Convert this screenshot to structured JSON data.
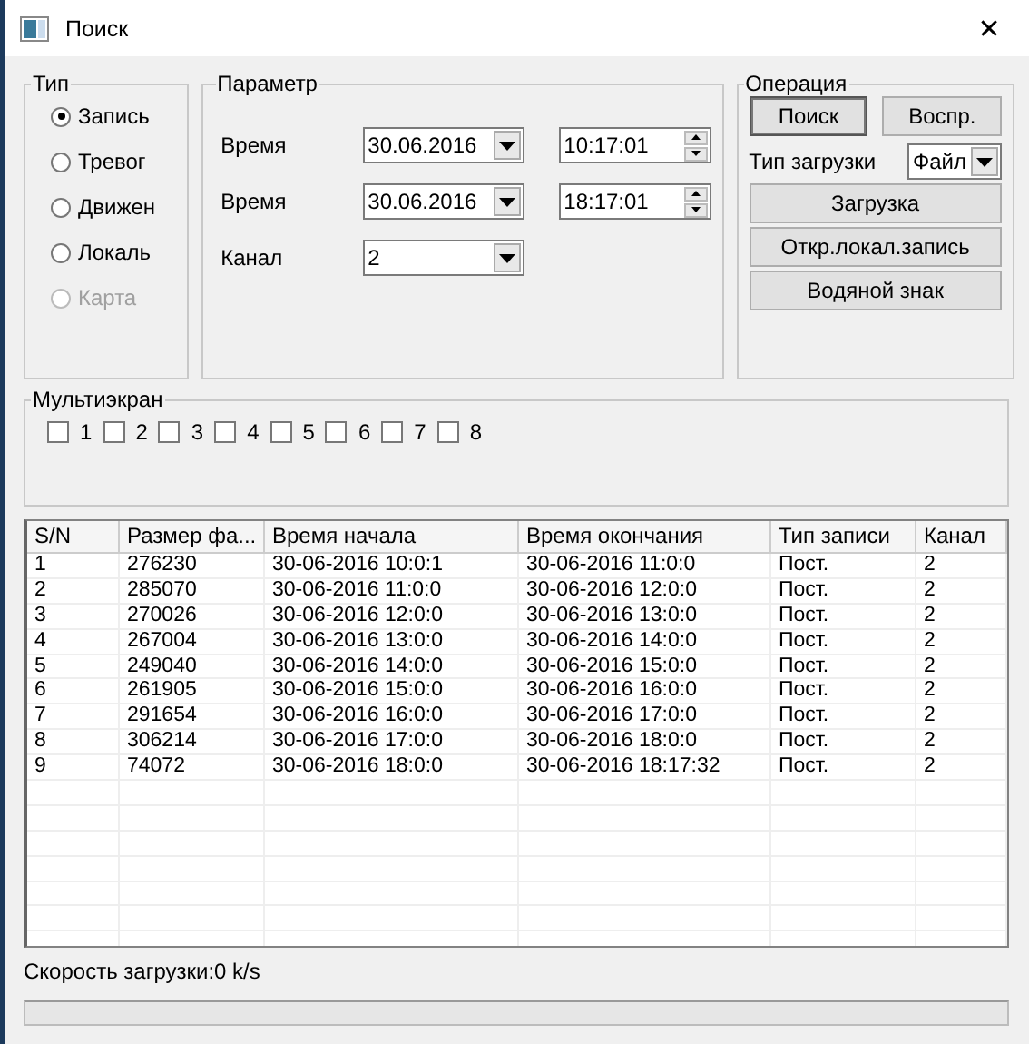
{
  "window": {
    "title": "Поиск",
    "close": "✕"
  },
  "type_group": {
    "title": "Тип",
    "options": [
      {
        "label": "Запись",
        "selected": true,
        "disabled": false
      },
      {
        "label": "Тревог",
        "selected": false,
        "disabled": false
      },
      {
        "label": "Движен",
        "selected": false,
        "disabled": false
      },
      {
        "label": "Локаль",
        "selected": false,
        "disabled": false
      },
      {
        "label": "Карта",
        "selected": false,
        "disabled": true
      }
    ]
  },
  "param_group": {
    "title": "Параметр",
    "rows": [
      {
        "kind": "datetime",
        "label": "Время",
        "date": "30.06.2016",
        "time": "10:17:01"
      },
      {
        "kind": "datetime",
        "label": "Время",
        "date": "30.06.2016",
        "time": "18:17:01"
      },
      {
        "kind": "select",
        "label": "Канал",
        "value": "2"
      }
    ]
  },
  "operation_group": {
    "title": "Операция",
    "search_button": "Поиск",
    "play_button": "Воспр.",
    "download_type_label": "Тип загрузки",
    "download_type_value": "Файл",
    "buttons": [
      "Загрузка",
      "Откр.локал.запись",
      "Водяной знак"
    ]
  },
  "multiscreen": {
    "title": "Мультиэкран",
    "checkboxes": [
      {
        "label": "1",
        "checked": false
      },
      {
        "label": "2",
        "checked": false
      },
      {
        "label": "3",
        "checked": false
      },
      {
        "label": "4",
        "checked": false
      },
      {
        "label": "5",
        "checked": false
      },
      {
        "label": "6",
        "checked": false
      },
      {
        "label": "7",
        "checked": false
      },
      {
        "label": "8",
        "checked": false
      }
    ]
  },
  "table": {
    "columns": [
      "S/N",
      "Размер фа...",
      "Время начала",
      "Время окончания",
      "Тип записи",
      "Канал"
    ],
    "rows": [
      [
        "1",
        "276230",
        "30-06-2016 10:0:1",
        "30-06-2016 11:0:0",
        "Пост.",
        "2"
      ],
      [
        "2",
        "285070",
        "30-06-2016 11:0:0",
        "30-06-2016 12:0:0",
        "Пост.",
        "2"
      ],
      [
        "3",
        "270026",
        "30-06-2016 12:0:0",
        "30-06-2016 13:0:0",
        "Пост.",
        "2"
      ],
      [
        "4",
        "267004",
        "30-06-2016 13:0:0",
        "30-06-2016 14:0:0",
        "Пост.",
        "2"
      ],
      [
        "5",
        "249040",
        "30-06-2016 14:0:0",
        "30-06-2016 15:0:0",
        "Пост.",
        "2"
      ],
      [
        "6",
        "261905",
        "30-06-2016 15:0:0",
        "30-06-2016 16:0:0",
        "Пост.",
        "2"
      ],
      [
        "7",
        "291654",
        "30-06-2016 16:0:0",
        "30-06-2016 17:0:0",
        "Пост.",
        "2"
      ],
      [
        "8",
        "306214",
        "30-06-2016 17:0:0",
        "30-06-2016 18:0:0",
        "Пост.",
        "2"
      ],
      [
        "9",
        "74072",
        "30-06-2016 18:0:0",
        "30-06-2016 18:17:32",
        "Пост.",
        "2"
      ]
    ]
  },
  "status": {
    "speed": "Скорость загрузки:0 k/s",
    "progress": {
      "level": 0
    }
  }
}
